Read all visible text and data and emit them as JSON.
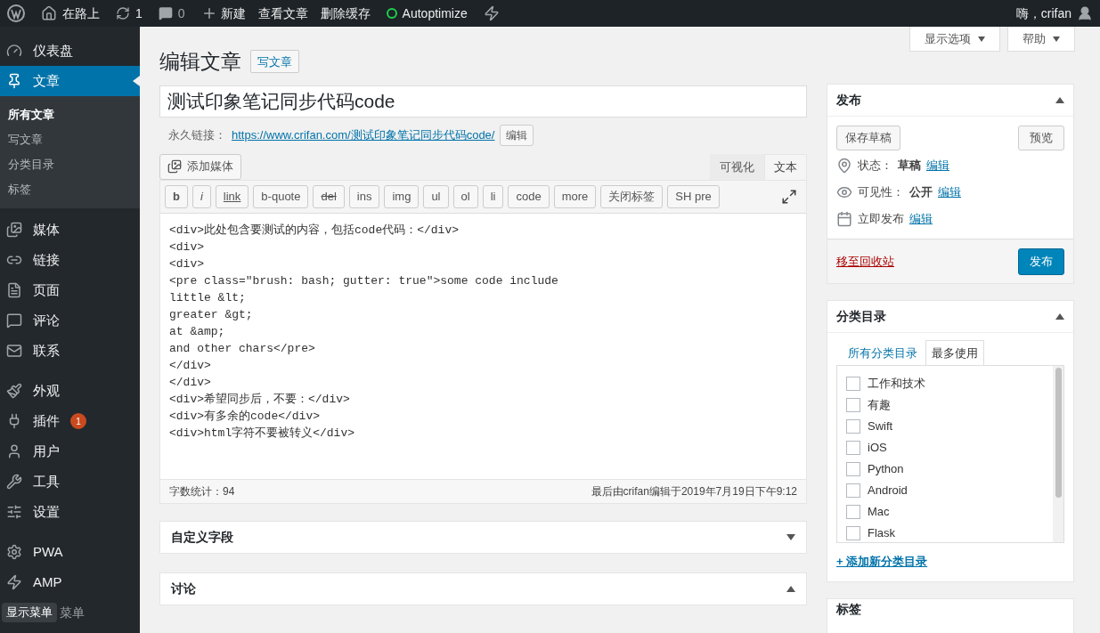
{
  "admin_bar": {
    "site": "在路上",
    "updates": "1",
    "comments": "0",
    "new": "新建",
    "links": [
      "查看文章",
      "删除缓存"
    ],
    "plugin": "Autoptimize",
    "greeting": "嗨，crifan"
  },
  "sidebar": {
    "items": [
      {
        "label": "仪表盘",
        "selected": false
      },
      {
        "label": "文章",
        "selected": true,
        "children": [
          {
            "label": "所有文章",
            "selected": true
          },
          {
            "label": "写文章",
            "selected": false
          },
          {
            "label": "分类目录",
            "selected": false
          },
          {
            "label": "标签",
            "selected": false
          }
        ]
      },
      {
        "label": "媒体",
        "selected": false
      },
      {
        "label": "链接",
        "selected": false
      },
      {
        "label": "页面",
        "selected": false
      },
      {
        "label": "评论",
        "selected": false
      },
      {
        "label": "联系",
        "selected": false
      },
      {
        "label": "外观",
        "selected": false
      },
      {
        "label": "插件",
        "selected": false,
        "badge": "1"
      },
      {
        "label": "用户",
        "selected": false
      },
      {
        "label": "工具",
        "selected": false
      },
      {
        "label": "设置",
        "selected": false
      },
      {
        "label": "PWA",
        "selected": false
      },
      {
        "label": "AMP",
        "selected": false
      }
    ],
    "collapse": "菜单",
    "tooltip": "显示菜单"
  },
  "screen_options": [
    "显示选项",
    "帮助"
  ],
  "heading": "编辑文章",
  "add_new": "写文章",
  "post_title": "测试印象笔记同步代码code",
  "permalink": {
    "label": "永久链接：",
    "url": "https://www.crifan.com/测试印象笔记同步代码code/",
    "edit": "编辑"
  },
  "add_media": "添加媒体",
  "editor_tabs": [
    {
      "label": "可视化",
      "selected": false
    },
    {
      "label": "文本",
      "selected": true
    }
  ],
  "quicktags": [
    {
      "label": "b",
      "kind": "bold"
    },
    {
      "label": "i",
      "kind": "italic"
    },
    {
      "label": "link",
      "kind": "underline"
    },
    {
      "label": "b-quote",
      "kind": "plain"
    },
    {
      "label": "del",
      "kind": "strike"
    },
    {
      "label": "ins",
      "kind": "plain"
    },
    {
      "label": "img",
      "kind": "plain"
    },
    {
      "label": "ul",
      "kind": "plain"
    },
    {
      "label": "ol",
      "kind": "plain"
    },
    {
      "label": "li",
      "kind": "plain"
    },
    {
      "label": "code",
      "kind": "plain"
    },
    {
      "label": "more",
      "kind": "plain"
    },
    {
      "label": "关闭标签",
      "kind": "plain"
    },
    {
      "label": "SH pre",
      "kind": "plain"
    }
  ],
  "content_lines": [
    "<div>此处包含要测试的内容，包括code代码：</div>",
    "<div>",
    "<div>",
    "<pre class=\"brush: bash; gutter: true\">some code include",
    "little &lt;",
    "greater &gt;",
    "at &amp;",
    "and other chars</pre>",
    "</div>",
    "</div>",
    "<div>希望同步后，不要：</div>",
    "<div>有多余的code</div>",
    "<div>html字符不要被转义</div>"
  ],
  "word_count": "字数统计：94",
  "last_edited": "最后由crifan编辑于2019年7月19日下午9:12",
  "panels": [
    {
      "title": "自定义字段",
      "expanded": false
    },
    {
      "title": "讨论",
      "expanded": true
    }
  ],
  "publish": {
    "title": "发布",
    "save_draft": "保存草稿",
    "preview": "预览",
    "rows": [
      {
        "label": "状态：",
        "value": "草稿",
        "edit": "编辑"
      },
      {
        "label": "可见性：",
        "value": "公开",
        "edit": "编辑"
      },
      {
        "label": "立即发布",
        "edit": "编辑"
      }
    ],
    "trash": "移至回收站",
    "submit": "发布"
  },
  "categories": {
    "title": "分类目录",
    "tabs": [
      {
        "label": "所有分类目录",
        "selected": false
      },
      {
        "label": "最多使用",
        "selected": true
      }
    ],
    "items": [
      {
        "label": "工作和技术",
        "checked": false
      },
      {
        "label": "有趣",
        "checked": false
      },
      {
        "label": "Swift",
        "checked": false
      },
      {
        "label": "iOS",
        "checked": false
      },
      {
        "label": "Python",
        "checked": false
      },
      {
        "label": "Android",
        "checked": false
      },
      {
        "label": "Mac",
        "checked": false
      },
      {
        "label": "Flask",
        "checked": false
      }
    ],
    "add": "+ 添加新分类目录"
  },
  "tags_panel": {
    "title": "标签"
  }
}
